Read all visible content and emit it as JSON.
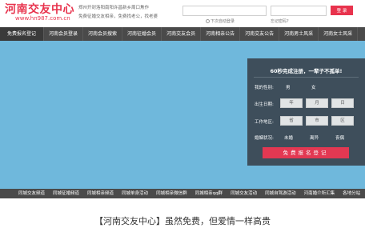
{
  "header": {
    "logo_title": "河南交友中心",
    "logo_url": "www.hn987.com.cn",
    "desc_line1": "郑州开封洛阳南阳许昌新乡周口焦作",
    "desc_line2": "免费征婚交友相亲，免费找老公，找老婆",
    "username_placeholder": "",
    "password_placeholder": "",
    "login_label": "登 录",
    "remember_label": "下次自动登录",
    "forgot_label": "忘记密码?"
  },
  "nav": {
    "items": [
      "免费报名登记",
      "河南会员登录",
      "河南会员搜索",
      "河南征婚会员",
      "河南交友会员",
      "河南相亲公告",
      "河南交友公告",
      "河南男士风采",
      "河南女士风采"
    ]
  },
  "panel": {
    "title": "60秒完成注册，一辈子不孤单!",
    "gender_label": "我的性别:",
    "gender_male": "男",
    "gender_female": "女",
    "birth_label": "出生日期:",
    "birth_year": "年",
    "birth_month": "月",
    "birth_day": "日",
    "area_label": "工作地区:",
    "area_province": "省",
    "area_city": "市",
    "area_county": "区",
    "marriage_label": "婚姻状况:",
    "marriage_opt1": "未婚",
    "marriage_opt2": "离异",
    "marriage_opt3": "丧偶",
    "register_label": "免费报名登记"
  },
  "bottom_nav": {
    "items": [
      "同城交友频道",
      "同城征婚频道",
      "同城相亲频道",
      "同城单身活动",
      "同城相亲微信群",
      "同城相亲qq群",
      "同城交友活动",
      "同城自驾游活动",
      "河南婚介所汇集",
      "各地分站"
    ]
  },
  "slogan": "【河南交友中心】虽然免费，但爱情一样高贵",
  "colors": {
    "accent": "#e8334d",
    "nav_bg": "#4a4a4a",
    "banner_bg": "#6fb8dc",
    "panel_bg": "#3d4a56"
  }
}
